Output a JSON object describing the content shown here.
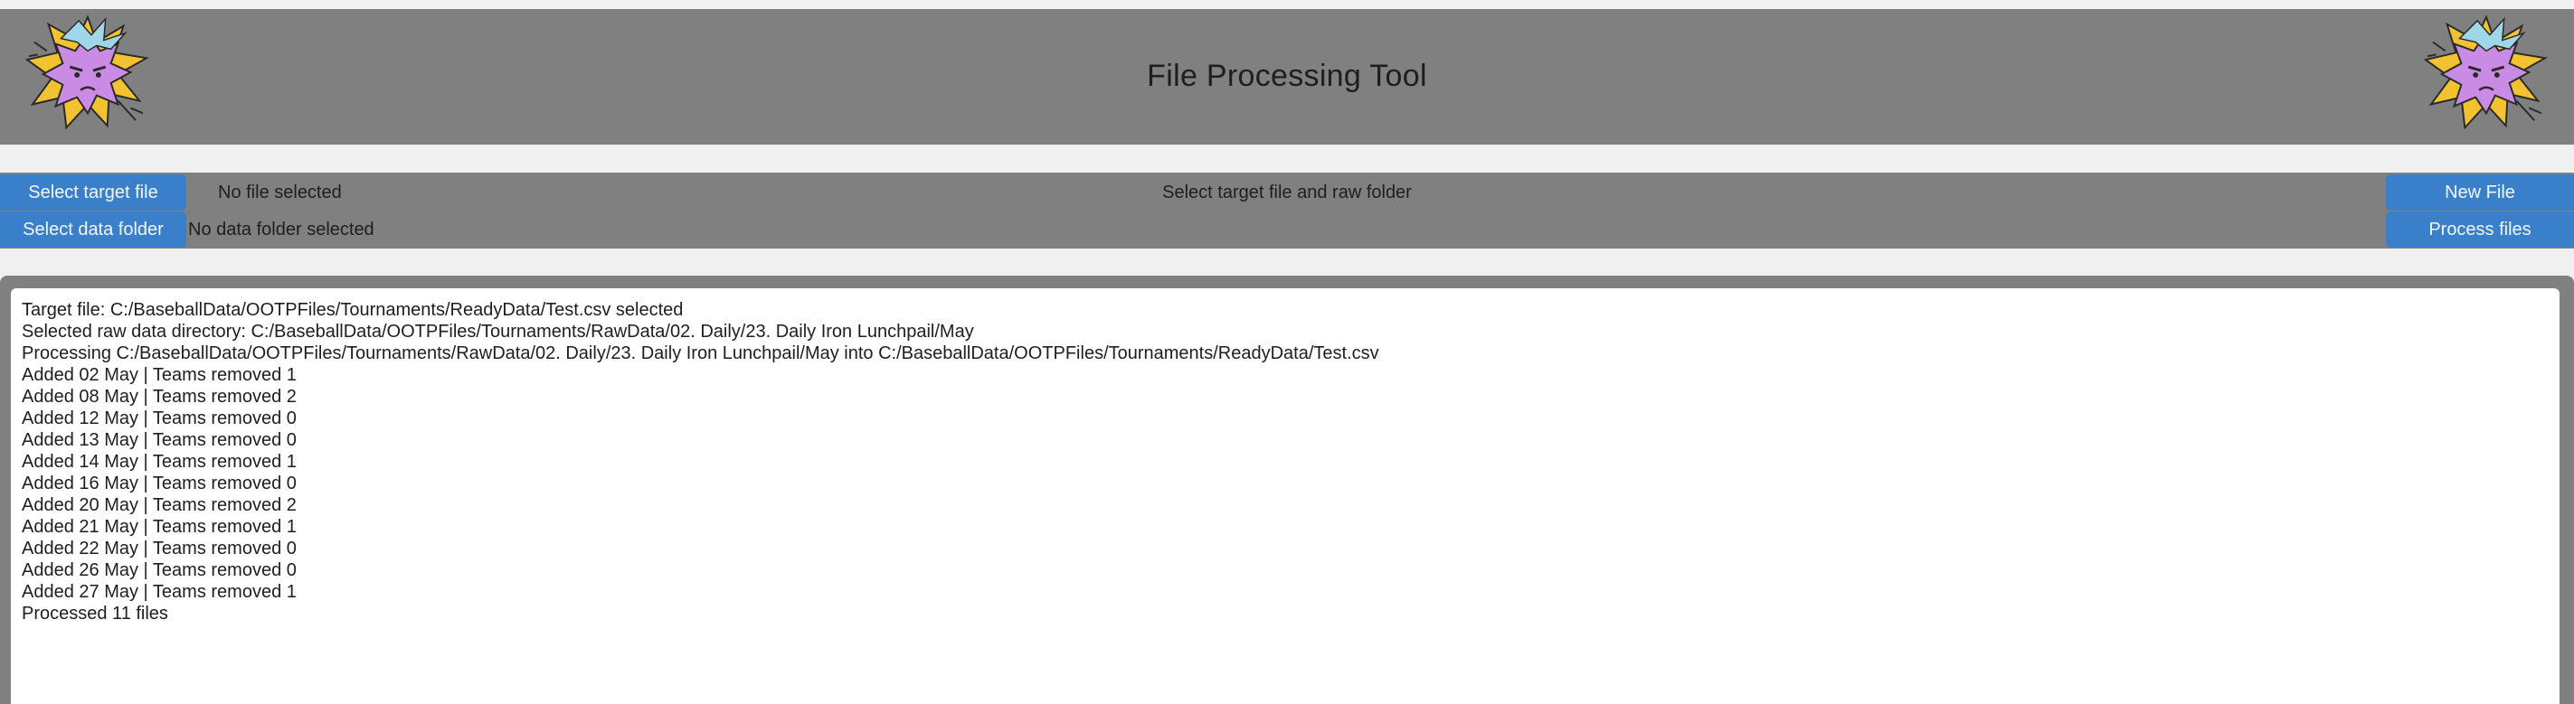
{
  "app": {
    "title": "File Processing Tool",
    "logo_icon": "spiky-purple-creature-logo-icon"
  },
  "controls": {
    "select_target_file_label": "Select target file",
    "select_data_folder_label": "Select data folder",
    "file_status": "No file selected",
    "folder_status": "No data folder selected",
    "instruction": "Select target file and raw folder",
    "new_file_label": "New File",
    "process_files_label": "Process files"
  },
  "colors": {
    "band": "#808080",
    "button": "#3a7fc9",
    "page_background": "#f0f0f0",
    "log_background": "#ffffff"
  },
  "log": {
    "lines": [
      "Target file: C:/BaseballData/OOTPFiles/Tournaments/ReadyData/Test.csv selected",
      "Selected raw data directory: C:/BaseballData/OOTPFiles/Tournaments/RawData/02. Daily/23. Daily Iron Lunchpail/May",
      "Processing C:/BaseballData/OOTPFiles/Tournaments/RawData/02. Daily/23. Daily Iron Lunchpail/May into C:/BaseballData/OOTPFiles/Tournaments/ReadyData/Test.csv",
      "Added 02 May | Teams removed 1",
      "Added 08 May | Teams removed 2",
      "Added 12 May | Teams removed 0",
      "Added 13 May | Teams removed 0",
      "Added 14 May | Teams removed 1",
      "Added 16 May | Teams removed 0",
      "Added 20 May | Teams removed 2",
      "Added 21 May | Teams removed 1",
      "Added 22 May | Teams removed 0",
      "Added 26 May | Teams removed 0",
      "Added 27 May | Teams removed 1",
      "Processed 11 files"
    ]
  }
}
